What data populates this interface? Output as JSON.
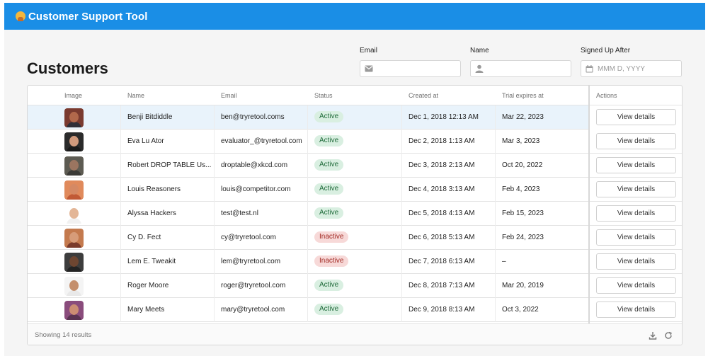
{
  "app": {
    "title": "Customer Support Tool"
  },
  "page": {
    "title": "Customers"
  },
  "filters": {
    "email": {
      "label": "Email",
      "placeholder": "",
      "value": ""
    },
    "name": {
      "label": "Name",
      "placeholder": "",
      "value": ""
    },
    "signed_up_after": {
      "label": "Signed Up After",
      "placeholder": "MMM D, YYYY",
      "value": ""
    }
  },
  "table": {
    "columns": [
      "Image",
      "Name",
      "Email",
      "Status",
      "Created at",
      "Trial expires at",
      "Actions"
    ],
    "rows": [
      {
        "name": "Benji Bitdiddle",
        "email": "ben@tryretool.coms",
        "status": "Active",
        "created": "Dec 1, 2018 12:13 AM",
        "trial": "Mar 22, 2023",
        "action": "View details",
        "skin": "#b2684b",
        "shirt": "#2f2f38",
        "bg": "#7a3a2f",
        "selected": true
      },
      {
        "name": "Eva Lu Ator",
        "email": "evaluator_@tryretool.com",
        "status": "Active",
        "created": "Dec 2, 2018 1:13 AM",
        "trial": "Mar 3, 2023",
        "action": "View details",
        "skin": "#d19a7c",
        "shirt": "#1a1a1a",
        "bg": "#2b2b2b",
        "selected": false
      },
      {
        "name": "Robert DROP TABLE Us...",
        "email": "droptable@xkcd.com",
        "status": "Active",
        "created": "Dec 3, 2018 2:13 AM",
        "trial": "Oct 20, 2022",
        "action": "View details",
        "skin": "#9b7560",
        "shirt": "#3b3a36",
        "bg": "#5d5b52",
        "selected": false
      },
      {
        "name": "Louis Reasoners",
        "email": "louis@competitor.com",
        "status": "Active",
        "created": "Dec 4, 2018 3:13 AM",
        "trial": "Feb 4, 2023",
        "action": "View details",
        "skin": "#d58964",
        "shirt": "#c15a36",
        "bg": "#e08a5c",
        "selected": false
      },
      {
        "name": "Alyssa Hackers",
        "email": "test@test.nl",
        "status": "Active",
        "created": "Dec 5, 2018 4:13 AM",
        "trial": "Feb 15, 2023",
        "action": "View details",
        "skin": "#e3b697",
        "shirt": "#f1f1f1",
        "bg": "#ffffff",
        "selected": false
      },
      {
        "name": "Cy D. Fect",
        "email": "cy@tryretool.com",
        "status": "Inactive",
        "created": "Dec 6, 2018 5:13 AM",
        "trial": "Feb 24, 2023",
        "action": "View details",
        "skin": "#d79c79",
        "shirt": "#7a3b2b",
        "bg": "#c47a4e",
        "selected": false
      },
      {
        "name": "Lem E. Tweakit",
        "email": "lem@tryretool.com",
        "status": "Inactive",
        "created": "Dec 7, 2018 6:13 AM",
        "trial": "–",
        "action": "View details",
        "skin": "#6e4631",
        "shirt": "#232323",
        "bg": "#3d3d3d",
        "selected": false
      },
      {
        "name": "Roger Moore",
        "email": "roger@tryretool.com",
        "status": "Active",
        "created": "Dec 8, 2018 7:13 AM",
        "trial": "Mar 20, 2019",
        "action": "View details",
        "skin": "#c48f6c",
        "shirt": "#e9e9e9",
        "bg": "#f4f4f4",
        "selected": false
      },
      {
        "name": "Mary Meets",
        "email": "mary@tryretool.com",
        "status": "Active",
        "created": "Dec 9, 2018 8:13 AM",
        "trial": "Oct 3, 2022",
        "action": "View details",
        "skin": "#cc8d73",
        "shirt": "#5a3452",
        "bg": "#8a4c7c",
        "selected": false
      }
    ],
    "footer": {
      "count_text": "Showing 14 results"
    }
  },
  "icons": {
    "email_field": "envelope-icon",
    "name_field": "person-icon",
    "date_field": "calendar-icon",
    "download": "download-icon",
    "refresh": "refresh-icon"
  },
  "colors": {
    "header": "#1a8ee6",
    "active_badge_bg": "#d9efe1",
    "active_badge_text": "#1f6b3a",
    "inactive_badge_bg": "#f7d9d8",
    "inactive_badge_text": "#a22a24",
    "selected_row": "#e9f3fb"
  }
}
